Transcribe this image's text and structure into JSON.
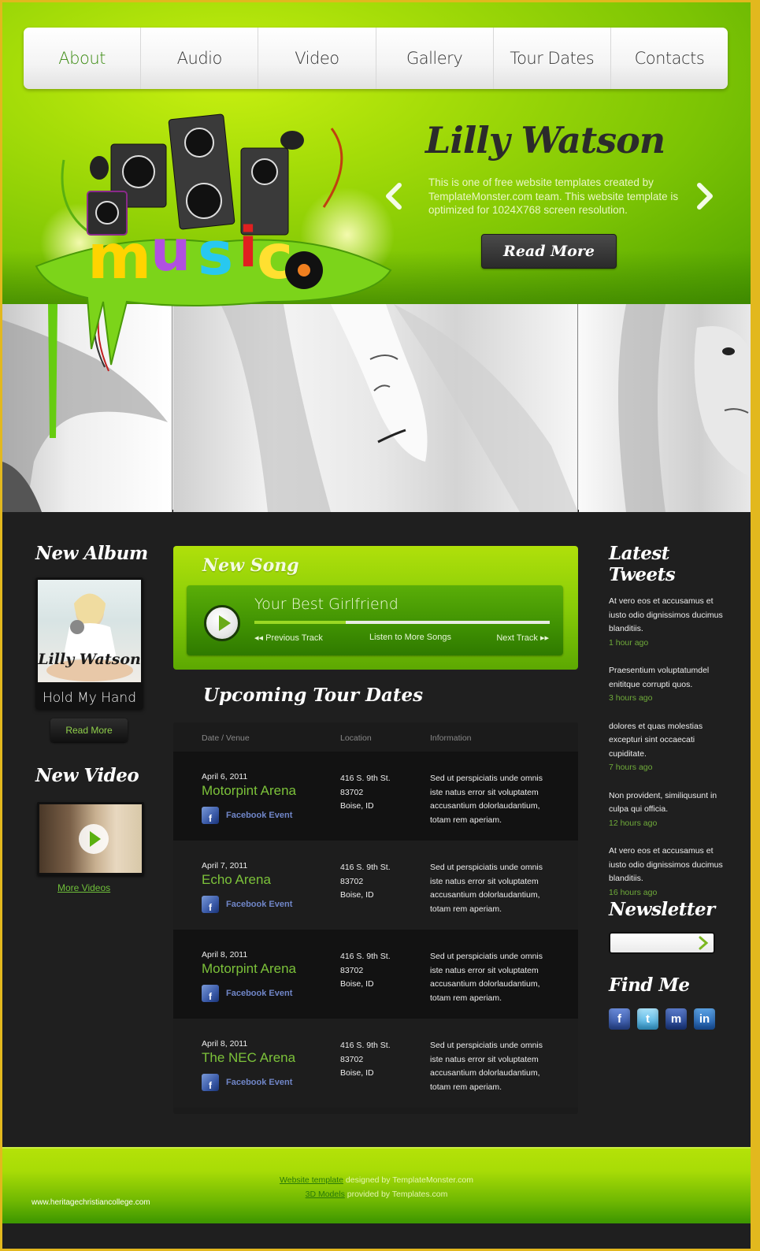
{
  "nav": {
    "items": [
      {
        "label": "About",
        "active": true
      },
      {
        "label": "Audio",
        "active": false
      },
      {
        "label": "Video",
        "active": false
      },
      {
        "label": "Gallery",
        "active": false
      },
      {
        "label": "Tour Dates",
        "active": false
      },
      {
        "label": "Contacts",
        "active": false
      }
    ]
  },
  "hero": {
    "logo_text": "music",
    "title": "Lilly Watson",
    "text": "This is one of free website templates created by TemplateMonster.com team. This website template is optimized for 1024X768 screen resolution.",
    "button": "Read More",
    "prev_icon": "chevron-left-icon",
    "next_icon": "chevron-right-icon"
  },
  "album": {
    "heading": "New Album",
    "artist": "Lilly Watson",
    "song": "Hold My Hand",
    "button": "Read More"
  },
  "video": {
    "heading": "New Video",
    "link": "More Videos"
  },
  "song": {
    "heading": "New Song",
    "track": "Your Best Girlfriend",
    "progress_percent": 31,
    "prev": "Previous Track",
    "listen": "Listen to More Songs",
    "next": "Next Track"
  },
  "tour": {
    "heading": "Upcoming Tour Dates",
    "columns": [
      "Date / Venue",
      "Location",
      "Information"
    ],
    "rows": [
      {
        "date": "April 6, 2011",
        "venue": "Motorpint Arena",
        "fb": "Facebook Event",
        "loc": [
          "416 S. 9th St.",
          "83702",
          "Boise, ID"
        ],
        "info": "Sed ut perspiciatis unde omnis iste natus error sit voluptatem accusantium dolorlaudantium, totam rem aperiam."
      },
      {
        "date": "April 7, 2011",
        "venue": "Echo Arena",
        "fb": "Facebook Event",
        "loc": [
          "416 S. 9th St.",
          "83702",
          "Boise, ID"
        ],
        "info": "Sed ut perspiciatis unde omnis iste natus error sit voluptatem accusantium dolorlaudantium, totam rem aperiam."
      },
      {
        "date": "April 8, 2011",
        "venue": "Motorpint Arena",
        "fb": "Facebook Event",
        "loc": [
          "416 S. 9th St.",
          "83702",
          "Boise, ID"
        ],
        "info": "Sed ut perspiciatis unde omnis iste natus error sit voluptatem accusantium dolorlaudantium, totam rem aperiam."
      },
      {
        "date": "April 8, 2011",
        "venue": "The NEC Arena",
        "fb": "Facebook Event",
        "loc": [
          "416 S. 9th St.",
          "83702",
          "Boise, ID"
        ],
        "info": "Sed ut perspiciatis unde omnis iste natus error sit voluptatem accusantium dolorlaudantium, totam rem aperiam."
      }
    ]
  },
  "tweets": {
    "heading": "Latest Tweets",
    "items": [
      {
        "text": "At vero eos et accusamus et iusto odio dignissimos ducimus blanditiis.",
        "time": "1 hour ago"
      },
      {
        "text": "Praesentium voluptatumdel enititque corrupti quos.",
        "time": "3 hours ago"
      },
      {
        "text": "dolores et quas molestias excepturi sint occaecati cupiditate.",
        "time": "7 hours ago"
      },
      {
        "text": "Non provident, similiqusunt in culpa qui officia.",
        "time": "12 hours ago"
      },
      {
        "text": "At vero eos et accusamus et iusto odio dignissimos ducimus blanditiis.",
        "time": "16 hours ago"
      }
    ]
  },
  "newsletter": {
    "heading": "Newsletter",
    "value": "",
    "placeholder": ""
  },
  "findme": {
    "heading": "Find Me",
    "socials": [
      {
        "name": "facebook",
        "glyph": "f"
      },
      {
        "name": "twitter",
        "glyph": "t"
      },
      {
        "name": "myspace",
        "glyph": "m"
      },
      {
        "name": "linkedin",
        "glyph": "in"
      }
    ]
  },
  "footer": {
    "line1_link": "Website template",
    "line1_text": " designed by TemplateMonster.com",
    "line2_link": "3D Models",
    "line2_text": " provided by Templates.com",
    "site": "www.heritagechristiancollege.com"
  },
  "colors": {
    "accent_green": "#7cc23a",
    "dark_bg": "#1f1f1f",
    "border_gold": "#e2b81e"
  }
}
